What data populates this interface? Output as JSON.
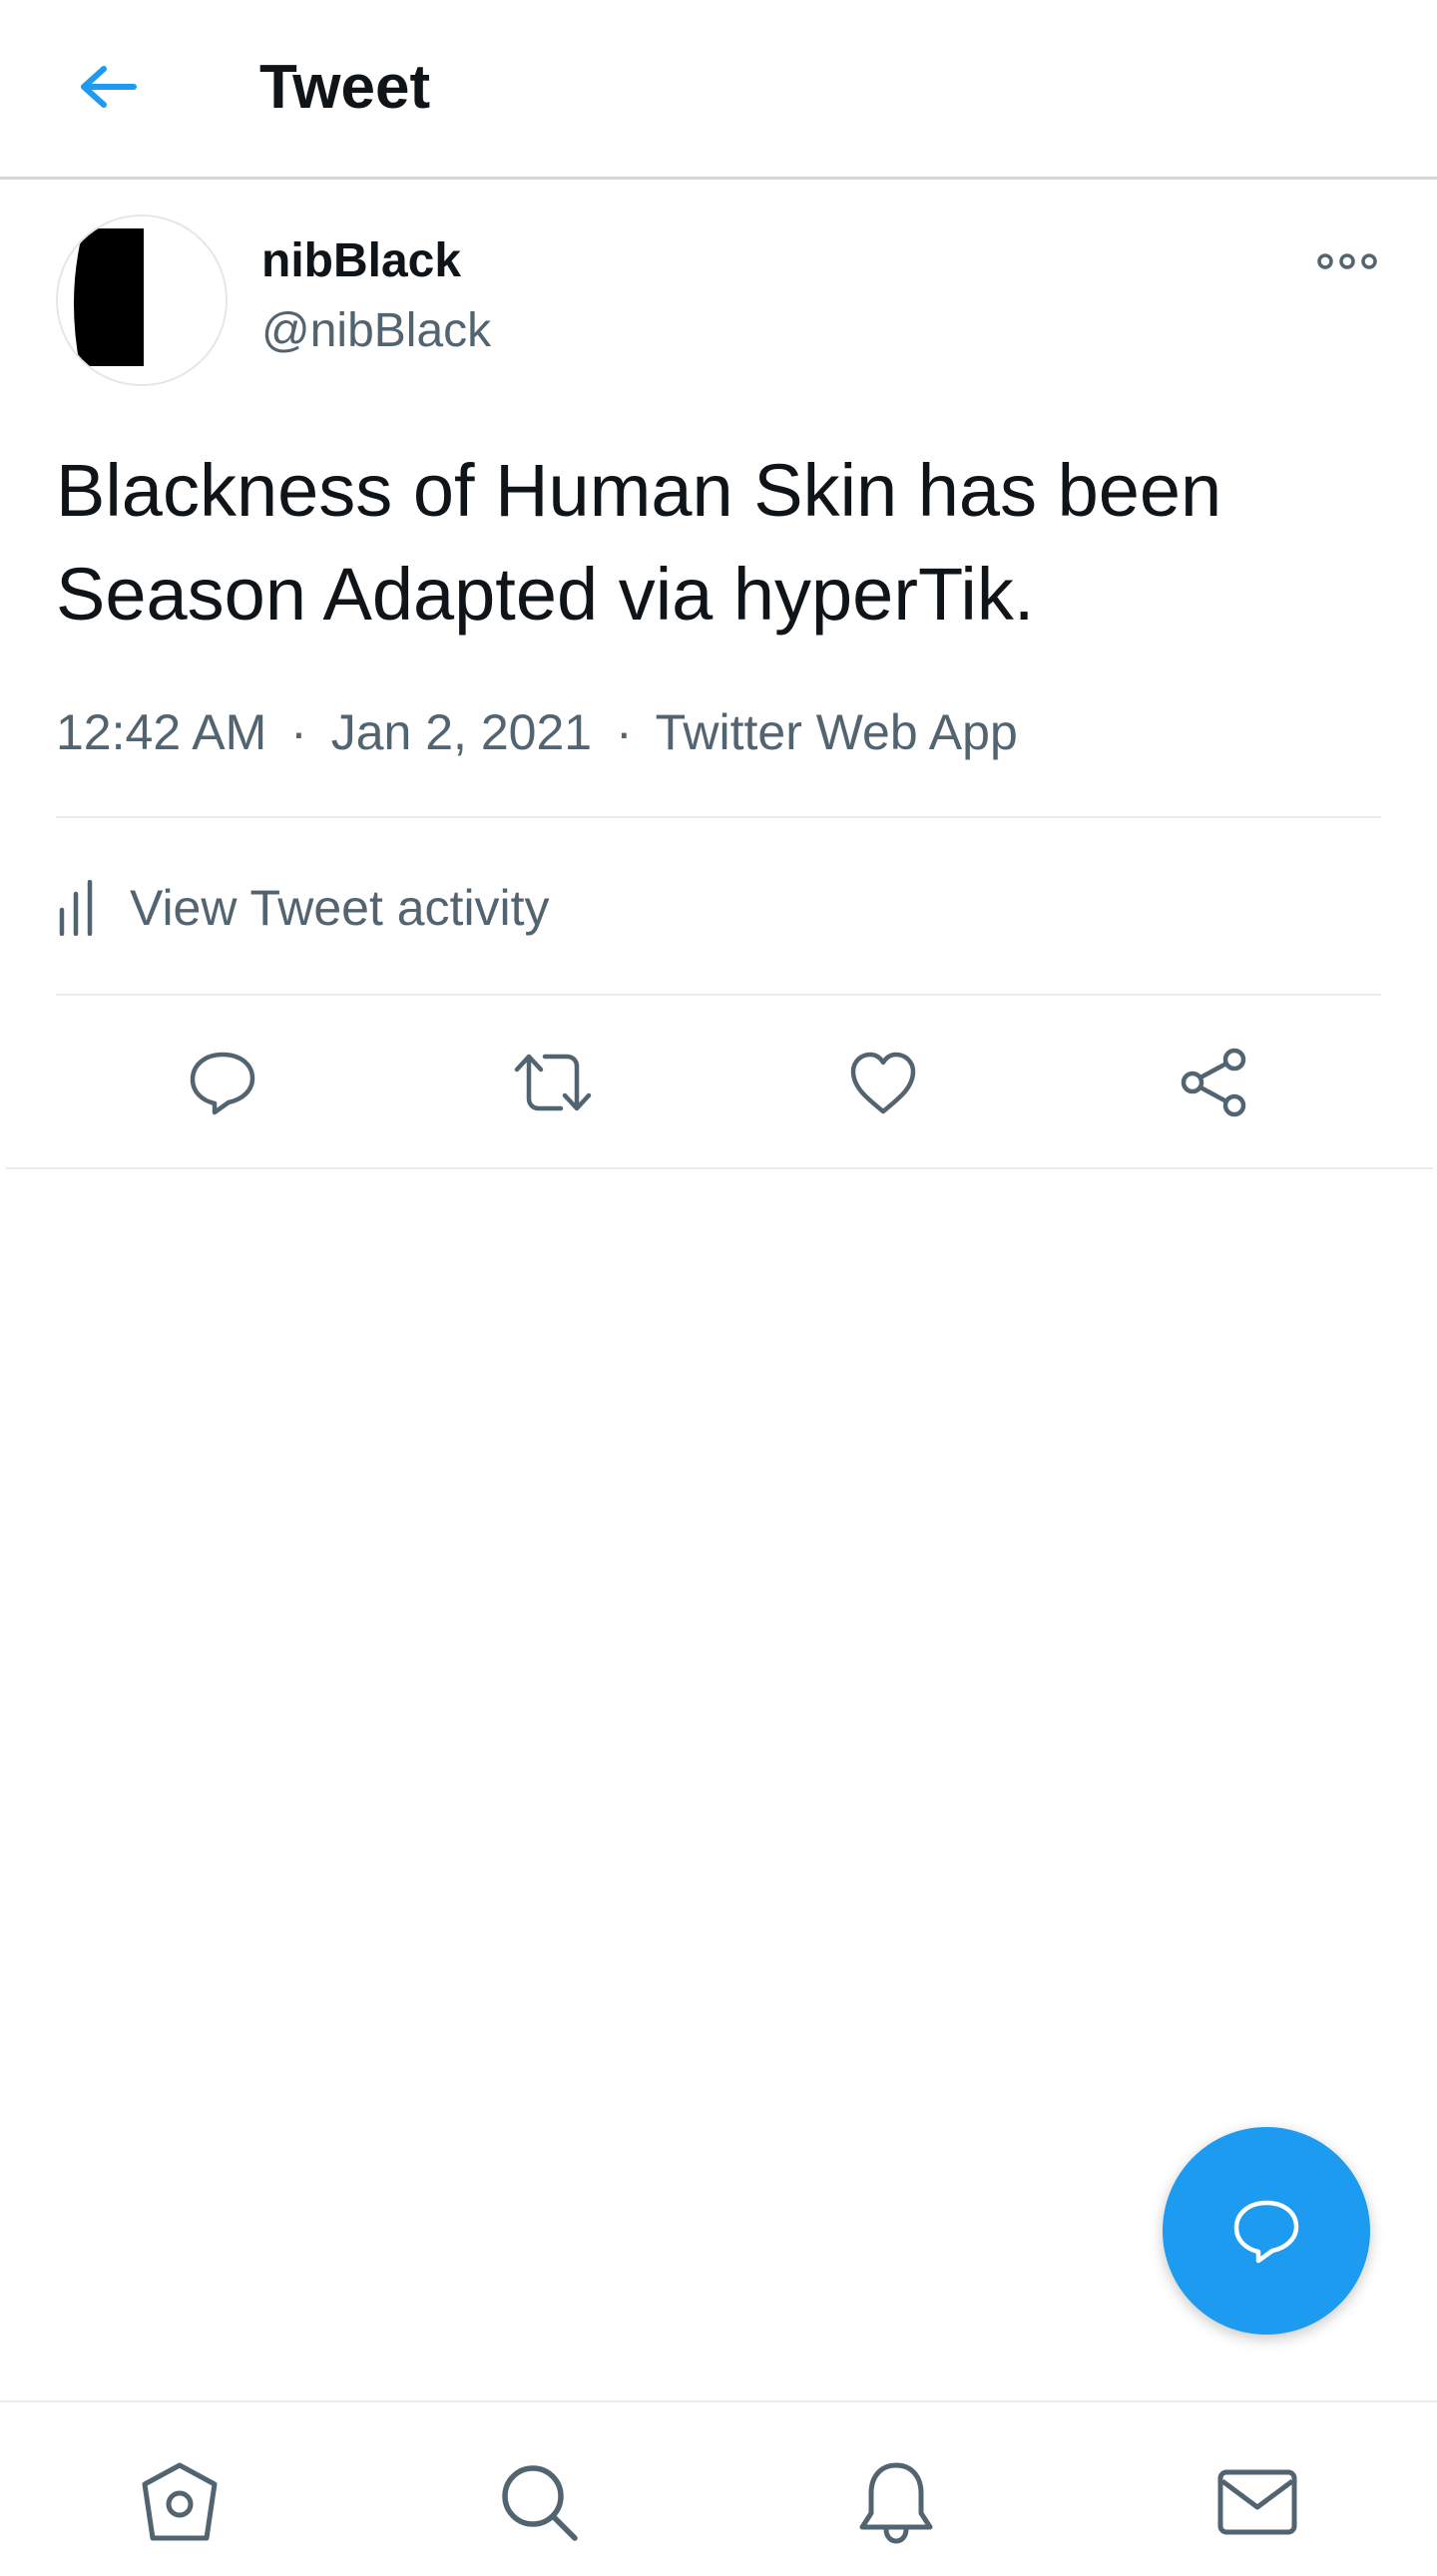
{
  "header": {
    "back_icon": "arrow-left-icon",
    "title": "Tweet"
  },
  "tweet": {
    "author": {
      "display_name": "nibBlack",
      "handle": "@nibBlack"
    },
    "more_icon": "more-options-icon",
    "text": "Blackness of Human Skin has been Season Adapted via hyperTik.",
    "time": "12:42 AM",
    "date": "Jan 2, 2021",
    "source": "Twitter Web App",
    "separator": "·",
    "activity_label": "View Tweet activity",
    "actions": [
      "reply-icon",
      "retweet-icon",
      "like-icon",
      "share-icon"
    ]
  },
  "fab": {
    "icon": "compose-reply-icon"
  },
  "bottom_nav": {
    "items": [
      "home-icon",
      "search-icon",
      "notifications-icon",
      "messages-icon"
    ]
  },
  "colors": {
    "accent": "#1d9bf0",
    "text_primary": "#0f1419",
    "text_secondary": "#536471",
    "divider": "#e6ecf0"
  }
}
